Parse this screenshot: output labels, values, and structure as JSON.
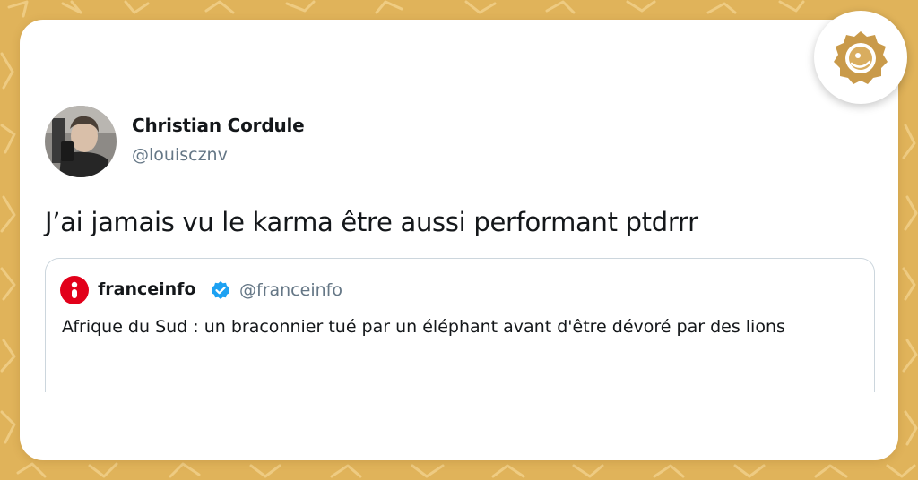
{
  "tweet": {
    "author_name": "Christian Cordule",
    "author_handle": "@louiscznv",
    "text": "J’ai jamais vu le karma être aussi performant ptdrrr"
  },
  "quoted_tweet": {
    "author_name": "franceinfo",
    "author_handle": "@franceinfo",
    "text": "Afrique du Sud : un braconnier tué par un éléphant avant d'être dévoré par des lions",
    "verified": true
  },
  "icons": {
    "badge": "publisher-logo-icon",
    "avatar": "avatar",
    "quote_logo": "franceinfo-logo-icon",
    "verified": "verified-badge-icon"
  },
  "colors": {
    "background": "#e0b35a",
    "card": "#ffffff",
    "verified_blue": "#1da1f2",
    "franceinfo_red": "#e2001a",
    "badge_gold": "#c99a4a"
  }
}
